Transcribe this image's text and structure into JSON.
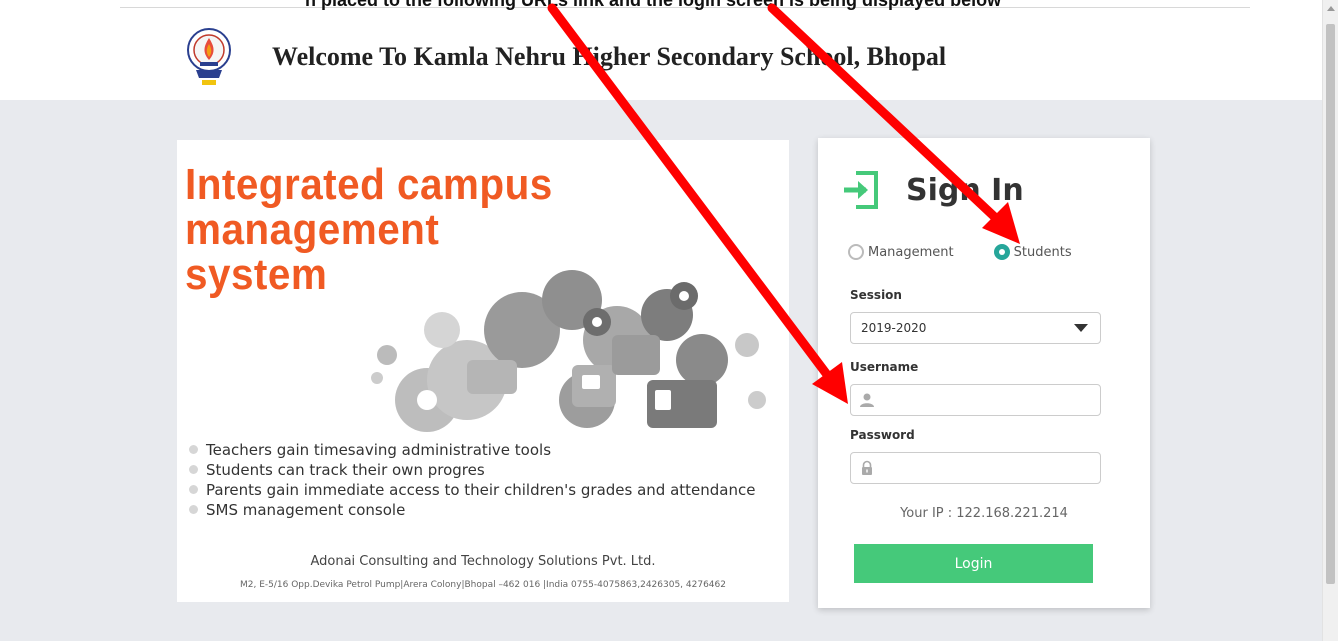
{
  "top_text": "n placed to the following URLs link and the login screen is being displayed below",
  "header": {
    "title": "Welcome To Kamla Nehru Higher Secondary School, Bhopal"
  },
  "promo": {
    "title_lines": [
      "Integrated campus",
      "management",
      "system"
    ],
    "bullets": [
      "Teachers gain timesaving administrative tools",
      "Students can track their own progres",
      "Parents gain immediate access to their children's grades and attendance",
      "SMS management console"
    ],
    "company": "Adonai Consulting and Technology Solutions Pvt. Ltd.",
    "address": "M2, E-5/16 Opp.Devika Petrol Pump|Arera Colony|Bhopal –462 016 |India 0755-4075863,2426305, 4276462"
  },
  "signin": {
    "title": "Sign In",
    "options": [
      {
        "label": "Management",
        "selected": false
      },
      {
        "label": "Students",
        "selected": true
      }
    ],
    "session_label": "Session",
    "session_value": "2019-2020",
    "username_label": "Username",
    "username_value": "",
    "password_label": "Password",
    "password_value": "",
    "ip_text": "Your IP : 122.168.221.214",
    "login_label": "Login"
  },
  "colors": {
    "accent_orange": "#f05a23",
    "accent_green": "#45c97a",
    "radio_teal": "#26a69a",
    "annotation_red": "#ff0000"
  },
  "icons": [
    "school-logo-icon",
    "sign-in-icon",
    "user-icon",
    "lock-icon",
    "dropdown-caret-icon"
  ]
}
